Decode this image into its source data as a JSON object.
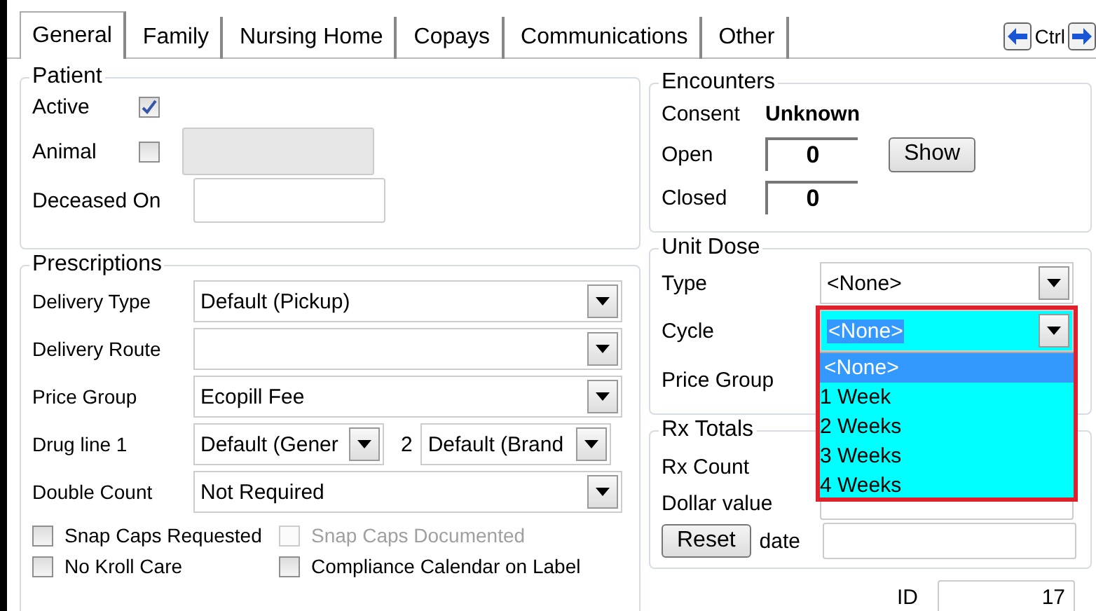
{
  "tabs": [
    {
      "label": "General",
      "selected": true
    },
    {
      "label": "Family",
      "selected": false
    },
    {
      "label": "Nursing Home",
      "selected": false
    },
    {
      "label": "Copays",
      "selected": false
    },
    {
      "label": "Communications",
      "selected": false
    },
    {
      "label": "Other",
      "selected": false
    }
  ],
  "tab_nav": {
    "label": "Ctrl"
  },
  "patient": {
    "title": "Patient",
    "active": {
      "label": "Active",
      "checked": true
    },
    "animal": {
      "label": "Animal",
      "checked": false
    },
    "deceased": {
      "label": "Deceased On"
    }
  },
  "prescriptions": {
    "title": "Prescriptions",
    "rows": [
      {
        "kind": "combo",
        "label": "Delivery Type",
        "value": "Default (Pickup)"
      },
      {
        "kind": "combo",
        "label": "Delivery Route"
      },
      {
        "kind": "combo",
        "label": "Price Group",
        "value": "Ecopill Fee"
      },
      {
        "kind": "pair",
        "label": "Drug line 1",
        "value": "Default (Gener",
        "second_label": "2",
        "second_value": "Default (Brand"
      },
      {
        "kind": "combo",
        "label": "Double Count",
        "value": "Not Required"
      }
    ],
    "checks": [
      {
        "label": "Snap Caps Requested",
        "checked": false,
        "disabled": false
      },
      {
        "label": "Snap Caps Documented",
        "checked": false,
        "disabled": true
      },
      {
        "label": "No Kroll Care",
        "checked": false,
        "disabled": false
      },
      {
        "label": "Compliance Calendar on Label",
        "checked": false,
        "disabled": false
      }
    ]
  },
  "encounters": {
    "title": "Encounters",
    "consent_label": "Consent",
    "consent_value": "Unknown",
    "open_label": "Open",
    "open_value": "0",
    "closed_label": "Closed",
    "closed_value": "0",
    "show_button": "Show"
  },
  "unit_dose": {
    "title": "Unit Dose",
    "type_label": "Type",
    "type_value": "<None>",
    "cycle_label": "Cycle",
    "cycle_value": "<None>",
    "price_group_label": "Price Group",
    "cycle_options": [
      {
        "label": "<None>",
        "selected": true
      },
      {
        "label": "1 Week",
        "selected": false
      },
      {
        "label": "2 Weeks",
        "selected": false
      },
      {
        "label": "3 Weeks",
        "selected": false
      },
      {
        "label": "4 Weeks",
        "selected": false
      }
    ]
  },
  "rx_totals": {
    "title": "Rx Totals",
    "count_label": "Rx Count",
    "dollar_label": "Dollar value",
    "reset_button": "Reset",
    "date_label": "date"
  },
  "id": {
    "label": "ID",
    "value": "17"
  }
}
